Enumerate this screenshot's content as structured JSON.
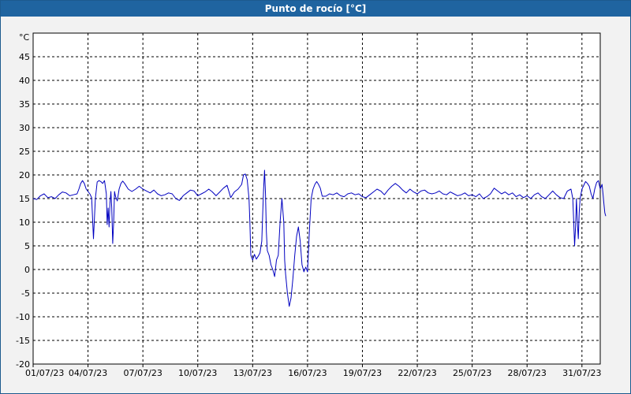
{
  "window": {
    "title": "Punto de rocío [°C]"
  },
  "chart_data": {
    "type": "line",
    "title": "Punto de rocío [°C]",
    "ylabel": "°C",
    "xlabel": "",
    "ylim": [
      -20,
      50
    ],
    "yticks": [
      -20,
      -15,
      -10,
      -5,
      0,
      5,
      10,
      15,
      20,
      25,
      30,
      35,
      40,
      45
    ],
    "xlim_days": [
      0,
      31
    ],
    "xtick_labels": [
      "01/07/23",
      "04/07/23",
      "07/07/23",
      "10/07/23",
      "13/07/23",
      "16/07/23",
      "19/07/23",
      "22/07/23",
      "25/07/23",
      "28/07/23",
      "31/07/23"
    ],
    "xtick_days": [
      0,
      3,
      6,
      9,
      12,
      15,
      18,
      21,
      24,
      27,
      30
    ],
    "grid": true,
    "series": [
      {
        "color": "#0000c0",
        "points": [
          [
            0.0,
            15.0
          ],
          [
            0.2,
            14.8
          ],
          [
            0.4,
            15.6
          ],
          [
            0.6,
            16.0
          ],
          [
            0.8,
            15.2
          ],
          [
            1.0,
            15.4
          ],
          [
            1.2,
            15.0
          ],
          [
            1.4,
            15.8
          ],
          [
            1.6,
            16.4
          ],
          [
            1.8,
            16.2
          ],
          [
            2.0,
            15.6
          ],
          [
            2.2,
            15.8
          ],
          [
            2.4,
            16.0
          ],
          [
            2.5,
            17.0
          ],
          [
            2.6,
            18.2
          ],
          [
            2.7,
            18.8
          ],
          [
            2.8,
            18.2
          ],
          [
            2.9,
            17.0
          ],
          [
            3.0,
            16.5
          ],
          [
            3.1,
            16.0
          ],
          [
            3.2,
            15.2
          ],
          [
            3.3,
            6.5
          ],
          [
            3.4,
            15.0
          ],
          [
            3.5,
            18.5
          ],
          [
            3.6,
            18.8
          ],
          [
            3.7,
            18.6
          ],
          [
            3.8,
            18.2
          ],
          [
            3.9,
            18.8
          ],
          [
            4.0,
            16.0
          ],
          [
            4.05,
            9.5
          ],
          [
            4.1,
            13.0
          ],
          [
            4.15,
            9.0
          ],
          [
            4.2,
            14.0
          ],
          [
            4.25,
            16.5
          ],
          [
            4.3,
            13.0
          ],
          [
            4.35,
            5.5
          ],
          [
            4.4,
            10.0
          ],
          [
            4.45,
            16.5
          ],
          [
            4.5,
            15.5
          ],
          [
            4.6,
            14.5
          ],
          [
            4.7,
            17.0
          ],
          [
            4.8,
            18.2
          ],
          [
            4.9,
            18.7
          ],
          [
            5.0,
            18.2
          ],
          [
            5.2,
            17.0
          ],
          [
            5.4,
            16.5
          ],
          [
            5.6,
            17.0
          ],
          [
            5.8,
            17.6
          ],
          [
            6.0,
            17.0
          ],
          [
            6.2,
            16.6
          ],
          [
            6.4,
            16.2
          ],
          [
            6.6,
            16.8
          ],
          [
            6.8,
            16.0
          ],
          [
            7.0,
            15.6
          ],
          [
            7.2,
            15.8
          ],
          [
            7.4,
            16.2
          ],
          [
            7.6,
            16.0
          ],
          [
            7.8,
            15.0
          ],
          [
            8.0,
            14.6
          ],
          [
            8.2,
            15.6
          ],
          [
            8.4,
            16.2
          ],
          [
            8.6,
            16.8
          ],
          [
            8.8,
            16.6
          ],
          [
            9.0,
            15.6
          ],
          [
            9.2,
            16.0
          ],
          [
            9.4,
            16.4
          ],
          [
            9.6,
            17.0
          ],
          [
            9.8,
            16.4
          ],
          [
            10.0,
            15.6
          ],
          [
            10.2,
            16.4
          ],
          [
            10.4,
            17.2
          ],
          [
            10.6,
            17.8
          ],
          [
            10.8,
            15.2
          ],
          [
            11.0,
            16.4
          ],
          [
            11.2,
            17.0
          ],
          [
            11.4,
            18.0
          ],
          [
            11.5,
            20.0
          ],
          [
            11.6,
            20.2
          ],
          [
            11.7,
            19.0
          ],
          [
            11.8,
            15.0
          ],
          [
            11.85,
            10.0
          ],
          [
            11.9,
            3.0
          ],
          [
            12.0,
            2.0
          ],
          [
            12.1,
            3.2
          ],
          [
            12.2,
            2.2
          ],
          [
            12.3,
            2.8
          ],
          [
            12.4,
            3.5
          ],
          [
            12.5,
            6.0
          ],
          [
            12.55,
            12.0
          ],
          [
            12.6,
            17.0
          ],
          [
            12.65,
            21.0
          ],
          [
            12.7,
            16.0
          ],
          [
            12.75,
            8.0
          ],
          [
            12.8,
            4.0
          ],
          [
            12.9,
            3.0
          ],
          [
            13.0,
            1.0
          ],
          [
            13.1,
            0.0
          ],
          [
            13.2,
            -1.5
          ],
          [
            13.3,
            2.0
          ],
          [
            13.4,
            3.0
          ],
          [
            13.5,
            10.0
          ],
          [
            13.6,
            15.0
          ],
          [
            13.7,
            10.0
          ],
          [
            13.75,
            2.0
          ],
          [
            13.8,
            -1.0
          ],
          [
            13.9,
            -5.0
          ],
          [
            14.0,
            -7.8
          ],
          [
            14.1,
            -6.0
          ],
          [
            14.2,
            -2.0
          ],
          [
            14.3,
            3.0
          ],
          [
            14.4,
            7.0
          ],
          [
            14.5,
            9.0
          ],
          [
            14.6,
            6.0
          ],
          [
            14.7,
            1.0
          ],
          [
            14.8,
            -0.5
          ],
          [
            14.9,
            0.5
          ],
          [
            15.0,
            -0.5
          ],
          [
            15.1,
            8.0
          ],
          [
            15.2,
            15.0
          ],
          [
            15.3,
            17.0
          ],
          [
            15.4,
            18.0
          ],
          [
            15.5,
            18.6
          ],
          [
            15.6,
            18.0
          ],
          [
            15.7,
            17.2
          ],
          [
            15.8,
            15.5
          ],
          [
            16.0,
            15.5
          ],
          [
            16.2,
            16.0
          ],
          [
            16.4,
            15.8
          ],
          [
            16.6,
            16.2
          ],
          [
            16.8,
            15.6
          ],
          [
            17.0,
            15.4
          ],
          [
            17.2,
            16.0
          ],
          [
            17.4,
            16.2
          ],
          [
            17.6,
            15.8
          ],
          [
            17.8,
            16.0
          ],
          [
            18.0,
            15.4
          ],
          [
            18.2,
            15.2
          ],
          [
            18.4,
            15.8
          ],
          [
            18.6,
            16.4
          ],
          [
            18.8,
            17.0
          ],
          [
            19.0,
            16.6
          ],
          [
            19.2,
            15.8
          ],
          [
            19.4,
            16.8
          ],
          [
            19.6,
            17.6
          ],
          [
            19.8,
            18.2
          ],
          [
            20.0,
            17.6
          ],
          [
            20.2,
            16.8
          ],
          [
            20.4,
            16.2
          ],
          [
            20.6,
            17.0
          ],
          [
            20.8,
            16.4
          ],
          [
            21.0,
            16.0
          ],
          [
            21.2,
            16.6
          ],
          [
            21.4,
            16.8
          ],
          [
            21.6,
            16.2
          ],
          [
            21.8,
            16.0
          ],
          [
            22.0,
            16.2
          ],
          [
            22.2,
            16.6
          ],
          [
            22.4,
            16.0
          ],
          [
            22.6,
            15.8
          ],
          [
            22.8,
            16.4
          ],
          [
            23.0,
            16.0
          ],
          [
            23.2,
            15.6
          ],
          [
            23.4,
            15.8
          ],
          [
            23.6,
            16.2
          ],
          [
            23.8,
            15.6
          ],
          [
            24.0,
            15.8
          ],
          [
            24.2,
            15.4
          ],
          [
            24.4,
            16.0
          ],
          [
            24.6,
            15.0
          ],
          [
            24.8,
            15.4
          ],
          [
            25.0,
            16.0
          ],
          [
            25.2,
            17.2
          ],
          [
            25.4,
            16.6
          ],
          [
            25.6,
            16.0
          ],
          [
            25.8,
            16.4
          ],
          [
            26.0,
            15.8
          ],
          [
            26.2,
            16.2
          ],
          [
            26.4,
            15.4
          ],
          [
            26.6,
            15.8
          ],
          [
            26.8,
            15.2
          ],
          [
            27.0,
            15.6
          ],
          [
            27.2,
            15.0
          ],
          [
            27.4,
            15.8
          ],
          [
            27.6,
            16.2
          ],
          [
            27.8,
            15.4
          ],
          [
            28.0,
            15.0
          ],
          [
            28.2,
            15.8
          ],
          [
            28.4,
            16.6
          ],
          [
            28.6,
            15.8
          ],
          [
            28.8,
            15.2
          ],
          [
            29.0,
            15.0
          ],
          [
            29.2,
            16.6
          ],
          [
            29.4,
            17.0
          ],
          [
            29.5,
            15.0
          ],
          [
            29.55,
            10.0
          ],
          [
            29.6,
            5.0
          ],
          [
            29.65,
            9.0
          ],
          [
            29.7,
            15.0
          ],
          [
            29.75,
            10.0
          ],
          [
            29.8,
            6.5
          ],
          [
            29.85,
            12.0
          ],
          [
            29.9,
            15.0
          ],
          [
            30.0,
            17.0
          ],
          [
            30.2,
            18.6
          ],
          [
            30.3,
            18.2
          ],
          [
            30.4,
            17.6
          ],
          [
            30.5,
            16.0
          ],
          [
            30.6,
            15.0
          ],
          [
            30.7,
            17.0
          ],
          [
            30.8,
            18.4
          ],
          [
            30.9,
            18.8
          ],
          [
            31.0,
            17.0
          ],
          [
            31.1,
            18.0
          ],
          [
            31.15,
            16.0
          ],
          [
            31.2,
            14.0
          ],
          [
            31.25,
            12.0
          ],
          [
            31.3,
            11.3
          ]
        ]
      }
    ]
  }
}
